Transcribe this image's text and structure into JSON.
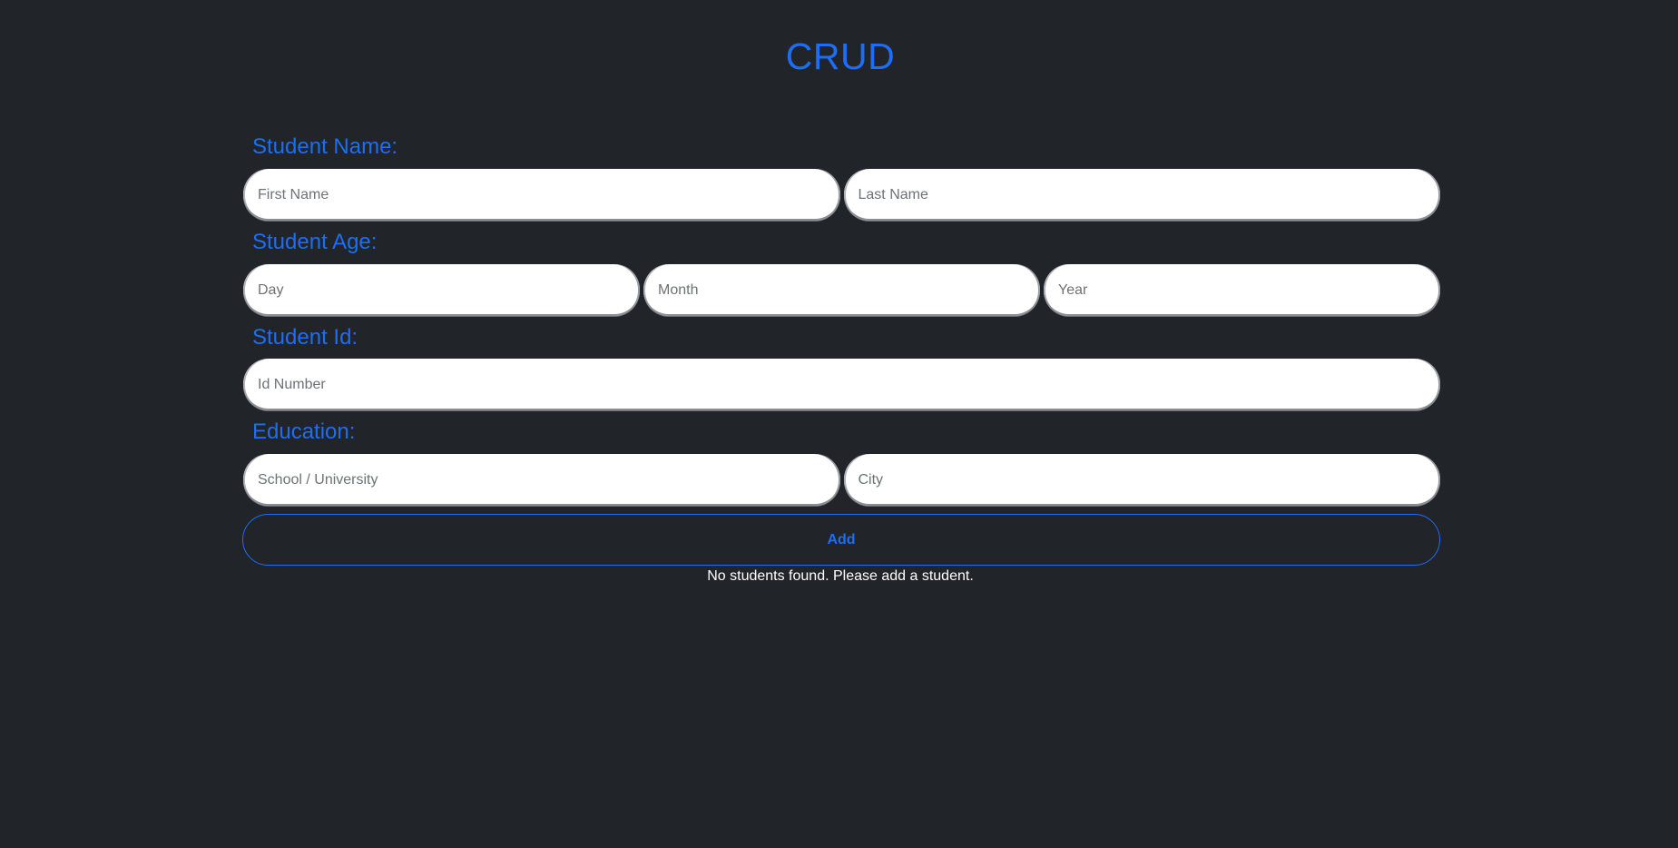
{
  "app": {
    "title": "CRUD"
  },
  "form": {
    "name": {
      "label": "Student Name:",
      "first_placeholder": "First Name",
      "last_placeholder": "Last Name"
    },
    "age": {
      "label": "Student Age:",
      "day_placeholder": "Day",
      "month_placeholder": "Month",
      "year_placeholder": "Year"
    },
    "id": {
      "label": "Student Id:",
      "id_placeholder": "Id Number"
    },
    "education": {
      "label": "Education:",
      "school_placeholder": "School / University",
      "city_placeholder": "City"
    },
    "add_label": "Add"
  },
  "students": {
    "empty_message": "No students found. Please add a student."
  },
  "colors": {
    "background": "#212429",
    "accent": "#1d6ef5",
    "field_background": "#ffffff",
    "text_light": "#ffffff"
  }
}
